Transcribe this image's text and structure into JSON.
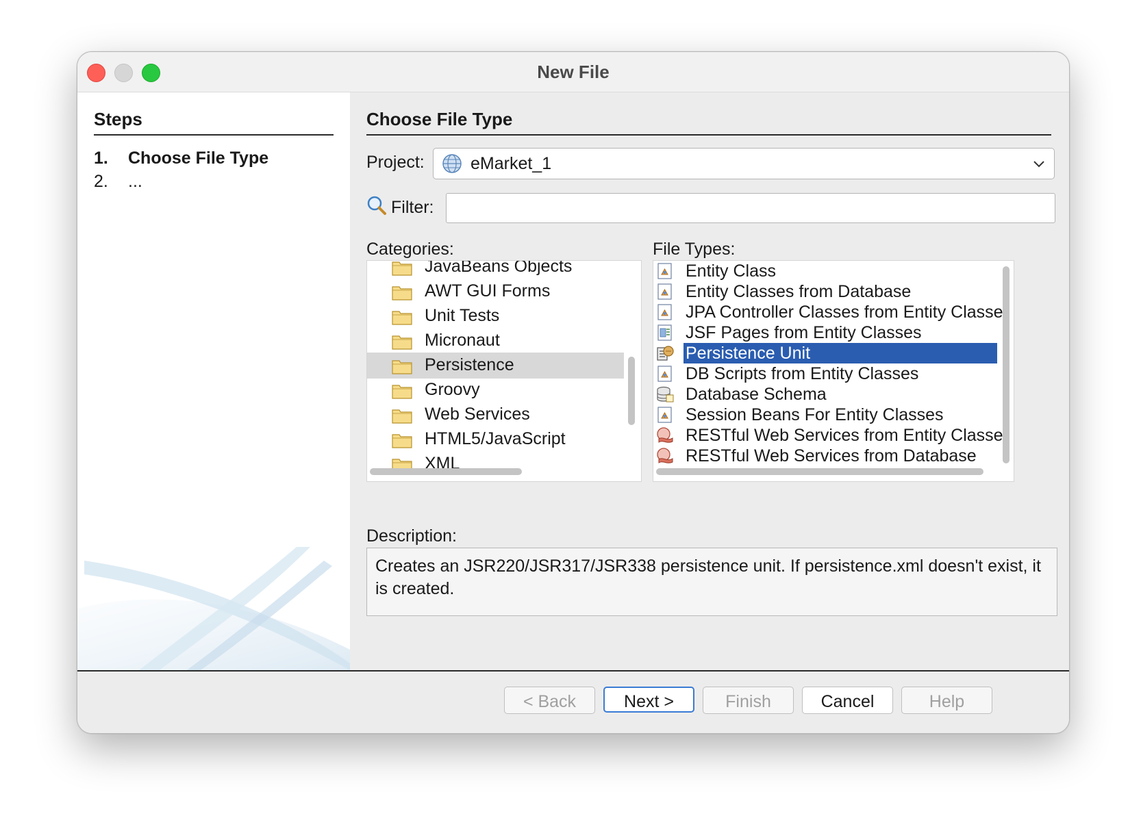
{
  "window": {
    "title": "New File"
  },
  "steps": {
    "heading": "Steps",
    "items": [
      {
        "num": "1.",
        "label": "Choose File Type"
      },
      {
        "num": "2.",
        "label": "..."
      }
    ]
  },
  "main": {
    "heading": "Choose File Type",
    "project_label": "Project:",
    "project_value": "eMarket_1",
    "filter_label": "Filter:",
    "filter_value": "",
    "categories_label": "Categories:",
    "categories": [
      "JavaBeans Objects",
      "AWT GUI Forms",
      "Unit Tests",
      "Micronaut",
      "Persistence",
      "Groovy",
      "Web Services",
      "HTML5/JavaScript",
      "XML"
    ],
    "selected_category": "Persistence",
    "file_types_label": "File Types:",
    "file_types": [
      {
        "label": "Entity Class",
        "icon": "entity-class-icon"
      },
      {
        "label": "Entity Classes from Database",
        "icon": "entity-class-icon"
      },
      {
        "label": "JPA Controller Classes from Entity Classe",
        "icon": "entity-class-icon"
      },
      {
        "label": "JSF Pages from Entity Classes",
        "icon": "jsf-page-icon"
      },
      {
        "label": "Persistence Unit",
        "icon": "persistence-unit-icon"
      },
      {
        "label": "DB Scripts from Entity Classes",
        "icon": "entity-class-icon"
      },
      {
        "label": "Database Schema",
        "icon": "database-schema-icon"
      },
      {
        "label": "Session Beans For Entity Classes",
        "icon": "entity-class-icon"
      },
      {
        "label": "RESTful Web Services from Entity Classe:",
        "icon": "restful-service-icon"
      },
      {
        "label": "RESTful Web Services from Database",
        "icon": "restful-service-icon"
      }
    ],
    "selected_file_type": "Persistence Unit",
    "description_label": "Description:",
    "description": "Creates an JSR220/JSR317/JSR338 persistence unit. If persistence.xml doesn't exist, it is created."
  },
  "buttons": {
    "back": "< Back",
    "next": "Next >",
    "finish": "Finish",
    "cancel": "Cancel",
    "help": "Help"
  },
  "colors": {
    "selection": "#2a5db0",
    "category_selection": "#d8d8d8",
    "default_button_border": "#3a7bd5",
    "close": "#fe5f57",
    "minimize": "#d6d6d6",
    "maximize": "#28c840"
  }
}
